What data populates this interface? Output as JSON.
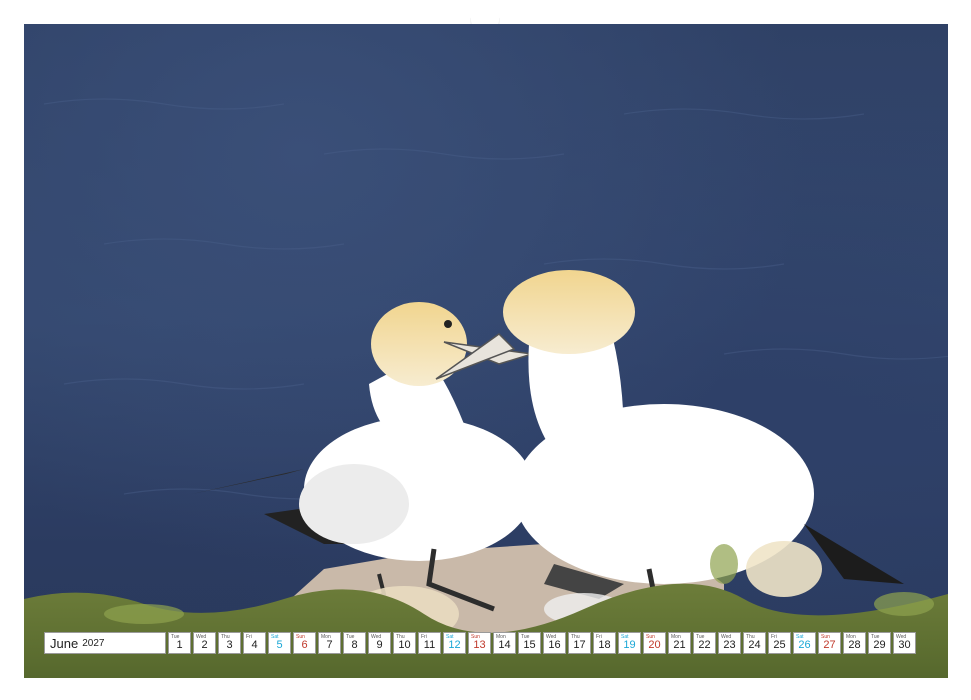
{
  "calendar": {
    "month": "June",
    "year": "2027",
    "days": [
      {
        "wd": "Tue",
        "n": "1",
        "kind": "weekday"
      },
      {
        "wd": "Wed",
        "n": "2",
        "kind": "weekday"
      },
      {
        "wd": "Thu",
        "n": "3",
        "kind": "weekday"
      },
      {
        "wd": "Fri",
        "n": "4",
        "kind": "weekday"
      },
      {
        "wd": "Sat",
        "n": "5",
        "kind": "sat"
      },
      {
        "wd": "Sun",
        "n": "6",
        "kind": "sun"
      },
      {
        "wd": "Mon",
        "n": "7",
        "kind": "weekday"
      },
      {
        "wd": "Tue",
        "n": "8",
        "kind": "weekday"
      },
      {
        "wd": "Wed",
        "n": "9",
        "kind": "weekday"
      },
      {
        "wd": "Thu",
        "n": "10",
        "kind": "weekday"
      },
      {
        "wd": "Fri",
        "n": "11",
        "kind": "weekday"
      },
      {
        "wd": "Sat",
        "n": "12",
        "kind": "sat"
      },
      {
        "wd": "Sun",
        "n": "13",
        "kind": "sun"
      },
      {
        "wd": "Mon",
        "n": "14",
        "kind": "weekday"
      },
      {
        "wd": "Tue",
        "n": "15",
        "kind": "weekday"
      },
      {
        "wd": "Wed",
        "n": "16",
        "kind": "weekday"
      },
      {
        "wd": "Thu",
        "n": "17",
        "kind": "weekday"
      },
      {
        "wd": "Fri",
        "n": "18",
        "kind": "weekday"
      },
      {
        "wd": "Sat",
        "n": "19",
        "kind": "sat"
      },
      {
        "wd": "Sun",
        "n": "20",
        "kind": "sun"
      },
      {
        "wd": "Mon",
        "n": "21",
        "kind": "weekday"
      },
      {
        "wd": "Tue",
        "n": "22",
        "kind": "weekday"
      },
      {
        "wd": "Wed",
        "n": "23",
        "kind": "weekday"
      },
      {
        "wd": "Thu",
        "n": "24",
        "kind": "weekday"
      },
      {
        "wd": "Fri",
        "n": "25",
        "kind": "weekday"
      },
      {
        "wd": "Sat",
        "n": "26",
        "kind": "sat"
      },
      {
        "wd": "Sun",
        "n": "27",
        "kind": "sun"
      },
      {
        "wd": "Mon",
        "n": "28",
        "kind": "weekday"
      },
      {
        "wd": "Tue",
        "n": "29",
        "kind": "weekday"
      },
      {
        "wd": "Wed",
        "n": "30",
        "kind": "weekday"
      }
    ]
  },
  "colors": {
    "saturday": "#1aa7d6",
    "sunday": "#c0392b",
    "sea": "#2f4166"
  }
}
